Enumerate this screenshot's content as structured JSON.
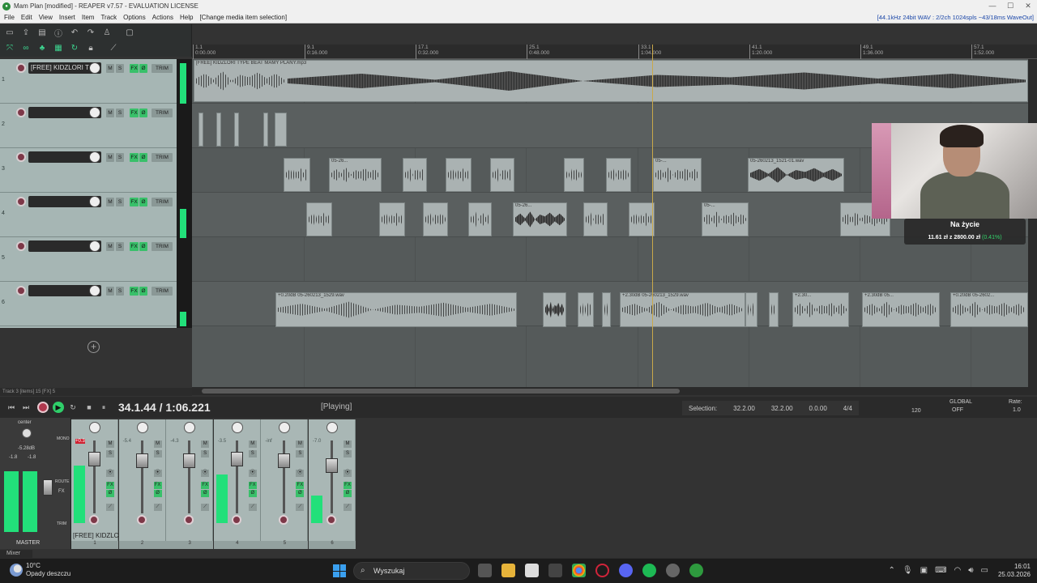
{
  "window": {
    "title": "Mam Plan [modified] - REAPER v7.57 - EVALUATION LICENSE"
  },
  "menu": {
    "items": [
      "File",
      "Edit",
      "View",
      "Insert",
      "Item",
      "Track",
      "Options",
      "Actions",
      "Help",
      "[Change media item selection]"
    ],
    "status": "[44.1kHz 24bit WAV : 2/2ch 1024spls ~43/18ms WaveOut]"
  },
  "ruler": {
    "marks": [
      {
        "bar": "1.1",
        "time": "0:00.000"
      },
      {
        "bar": "9.1",
        "time": "0:16.000"
      },
      {
        "bar": "17.1",
        "time": "0:32.000"
      },
      {
        "bar": "25.1",
        "time": "0:48.000"
      },
      {
        "bar": "33.1",
        "time": "1:04.000"
      },
      {
        "bar": "41.1",
        "time": "1:20.000"
      },
      {
        "bar": "49.1",
        "time": "1:36.000"
      },
      {
        "bar": "57.1",
        "time": "1:52.000"
      }
    ]
  },
  "tracks": [
    {
      "num": "1",
      "name": "[FREE] KIDZLORI T"
    },
    {
      "num": "2",
      "name": ""
    },
    {
      "num": "3",
      "name": ""
    },
    {
      "num": "4",
      "name": ""
    },
    {
      "num": "5",
      "name": ""
    },
    {
      "num": "6",
      "name": ""
    }
  ],
  "track_buttons": {
    "mute": "M",
    "solo": "S",
    "fx": "FX",
    "phase": "Ø",
    "trim": "TRIM"
  },
  "items": {
    "track1_label": "[FREE] KIDZLORI TYPE BEAT MAMY PLANY.mp3",
    "track3_label_a": "05-26...",
    "track3_label_b": "05-...",
    "track3_label_c": "05-260213_1521-01.wav",
    "track4_label_a": "05-26...",
    "track4_label_b": "05-...",
    "track6_label_a": "+0.20dB 05-260213_1529.wav",
    "track6_label_b": "+2.30dB 05-260213_1529.wav",
    "track6_label_c": "+2.30...",
    "track6_label_d": "+2.30dB 05...",
    "track6_label_e": "+0.20dB 05-2602..."
  },
  "statusline": "Track 3 [items] 15 [FX] 5",
  "transport": {
    "time": "34.1.44 / 1:06.221",
    "state": "[Playing]",
    "selection_label": "Selection:",
    "sel_start": "32.2.00",
    "sel_end": "32.2.00",
    "sel_len": "0.0.00",
    "timesig": "4/4",
    "bpm": "120",
    "global": "GLOBAL",
    "off": "OFF",
    "rate_label": "Rate:",
    "rate_value": "1.0"
  },
  "master": {
    "label": "MASTER",
    "pan": "center",
    "db": "-5.28dB",
    "left": "-1.8",
    "right": "-1.8",
    "mono": "MONO",
    "route": "ROUTE",
    "fx": "FX",
    "trim": "TRIM"
  },
  "mixer_strips": [
    {
      "num": "1",
      "name": "[FREE] KIDZLC",
      "peak": "+0.3",
      "meter": 0.85
    },
    {
      "num": "2",
      "name": "",
      "peak": "-5.4",
      "meter": 0.0
    },
    {
      "num": "3",
      "name": "",
      "peak": "-4.3",
      "meter": 0.0
    },
    {
      "num": "4",
      "name": "",
      "peak": "-3.5",
      "meter": 0.72
    },
    {
      "num": "5",
      "name": "",
      "peak": "-inf",
      "meter": 0.0
    },
    {
      "num": "6",
      "name": "",
      "peak": "-7.0",
      "meter": 0.4
    }
  ],
  "mixer_tab": "Mixer",
  "webcam": {
    "title": "Na życie",
    "progress_text": "11.61 zł z 2800.00 zł",
    "progress_pct": "(0.41%)"
  },
  "taskbar": {
    "weather_temp": "10°C",
    "weather_desc": "Opady deszczu",
    "search_placeholder": "Wyszukaj",
    "time": "16:01",
    "date": "25.03.2026"
  },
  "colors": {
    "accent_green": "#22e07a",
    "track_panel": "#a6b6b4",
    "arrange_bg": "#555a5a",
    "cursor": "#c9a84a"
  }
}
